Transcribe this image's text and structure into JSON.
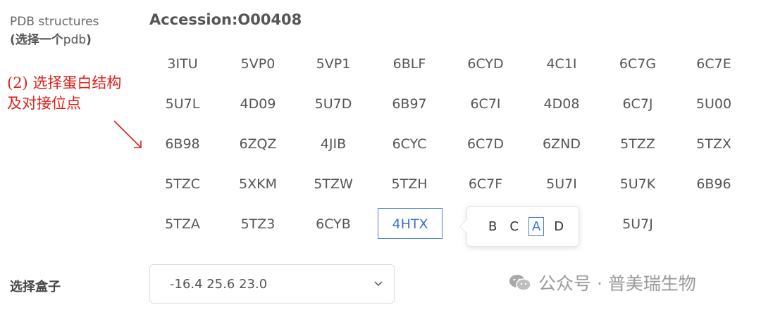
{
  "side_label": {
    "line1": "PDB structures",
    "line2_cn_a": "(选择一个",
    "line2_en": "pdb",
    "line2_cn_b": ")"
  },
  "accession": "Accession:O00408",
  "annotation": {
    "line1": "(2) 选择蛋白结构",
    "line2": "及对接位点"
  },
  "pdb_rows": [
    [
      "3ITU",
      "5VP0",
      "5VP1",
      "6BLF",
      "6CYD",
      "4C1I",
      "6C7G",
      "6C7E"
    ],
    [
      "5U7L",
      "4D09",
      "5U7D",
      "6B97",
      "6C7I",
      "4D08",
      "6C7J",
      "5U00"
    ],
    [
      "6B98",
      "6ZQZ",
      "4JIB",
      "6CYC",
      "6C7D",
      "6ZND",
      "5TZZ",
      "5TZX"
    ],
    [
      "5TZC",
      "5XKM",
      "5TZW",
      "5TZH",
      "6C7F",
      "5U7I",
      "5U7K",
      "6B96"
    ],
    [
      "5TZA",
      "5TZ3",
      "6CYB",
      "4HTX",
      "",
      "",
      "5U7J",
      ""
    ]
  ],
  "selected_pdb": "4HTX",
  "chains": [
    "B",
    "C",
    "A",
    "D"
  ],
  "selected_chain": "A",
  "box": {
    "label": "选择盒子",
    "value": "-16.4 25.6 23.0"
  },
  "watermark": "公众号 · 普美瑞生物",
  "colors": {
    "accent": "#4a7fd8",
    "annotation": "#e0201a"
  }
}
